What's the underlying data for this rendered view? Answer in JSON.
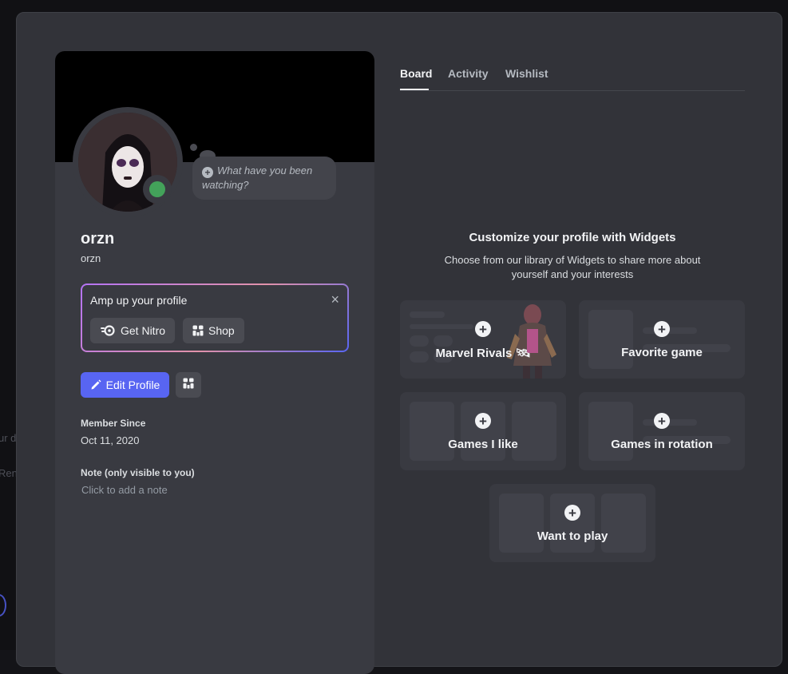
{
  "background": {
    "fragment_1": "ur d",
    "fragment_2": "Ren"
  },
  "profile": {
    "status_prompt": "What have you been watching?",
    "display_name": "orzn",
    "username": "orzn",
    "promo": {
      "title": "Amp up your profile",
      "close_icon": "×",
      "nitro_label": "Get Nitro",
      "shop_label": "Shop"
    },
    "edit_label": "Edit Profile",
    "member_since_label": "Member Since",
    "member_since_value": "Oct 11, 2020",
    "note_label": "Note (only visible to you)",
    "note_placeholder": "Click to add a note",
    "status_color": "#43a25a",
    "accent_color": "#5865f2"
  },
  "tabs": [
    {
      "label": "Board",
      "active": true
    },
    {
      "label": "Activity",
      "active": false
    },
    {
      "label": "Wishlist",
      "active": false
    }
  ],
  "widgets": {
    "title": "Customize your profile with Widgets",
    "description": "Choose from our library of Widgets to share more about yourself and your interests",
    "items": [
      {
        "label": "Marvel Rivals 🛰"
      },
      {
        "label": "Favorite game"
      },
      {
        "label": "Games I like"
      },
      {
        "label": "Games in rotation"
      },
      {
        "label": "Want to play"
      }
    ]
  }
}
